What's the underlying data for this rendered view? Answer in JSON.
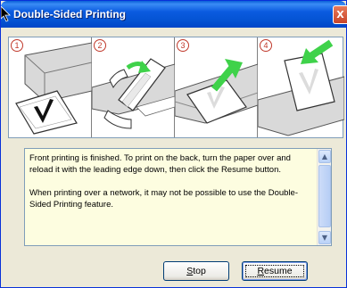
{
  "window": {
    "title": "Double-Sided Printing",
    "close_glyph": "X"
  },
  "steps": [
    {
      "number": "1",
      "icon": "printed-sheet-in-tray-icon"
    },
    {
      "number": "2",
      "icon": "turn-paper-over-icon"
    },
    {
      "number": "3",
      "icon": "reload-paper-icon"
    },
    {
      "number": "4",
      "icon": "insert-paper-icon"
    }
  ],
  "message": {
    "paragraph1": "Front printing is finished. To print on the back, turn the paper over and reload it with the leading edge down, then click the Resume button.",
    "paragraph2": "When printing over a network, it may not be possible to use the Double-Sided Printing feature."
  },
  "scrollbar": {
    "up_glyph": "▲",
    "down_glyph": "▼"
  },
  "buttons": {
    "stop_first": "S",
    "stop_rest": "top",
    "resume_first": "R",
    "resume_rest": "esume"
  },
  "colors": {
    "titlebar": "#0554d4",
    "dialog_bg": "#ece9d8",
    "message_bg": "#fdfde0",
    "arrow_green": "#3fd24a"
  }
}
